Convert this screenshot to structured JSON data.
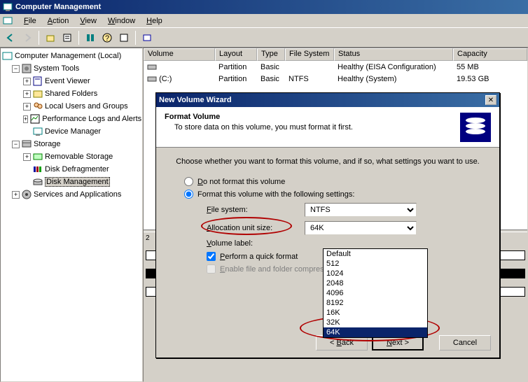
{
  "app": {
    "title": "Computer Management"
  },
  "menu": {
    "file": "File",
    "action": "Action",
    "view": "View",
    "window": "Window",
    "help": "Help"
  },
  "tree": {
    "root": "Computer Management (Local)",
    "systools": "System Tools",
    "eventviewer": "Event Viewer",
    "sharedfolders": "Shared Folders",
    "localusers": "Local Users and Groups",
    "perflogs": "Performance Logs and Alerts",
    "devmgr": "Device Manager",
    "storage": "Storage",
    "removable": "Removable Storage",
    "defrag": "Disk Defragmenter",
    "diskmgmt": "Disk Management",
    "services": "Services and Applications"
  },
  "cols": {
    "volume": "Volume",
    "layout": "Layout",
    "type": "Type",
    "fs": "File System",
    "status": "Status",
    "capacity": "Capacity"
  },
  "rows": [
    {
      "vol": "",
      "layout": "Partition",
      "type": "Basic",
      "fs": "",
      "status": "Healthy (EISA Configuration)",
      "cap": "55 MB"
    },
    {
      "vol": "(C:)",
      "layout": "Partition",
      "type": "Basic",
      "fs": "NTFS",
      "status": "Healthy (System)",
      "cap": "19.53 GB"
    }
  ],
  "wizard": {
    "title": "New Volume Wizard",
    "h1": "Format Volume",
    "h2": "To store data on this volume, you must format it first.",
    "intro": "Choose whether you want to format this volume, and if so, what settings you want to use.",
    "opt1": "Do not format this volume",
    "opt2": "Format this volume with the following settings:",
    "fs_label": "File system:",
    "fs_value": "NTFS",
    "au_label": "Allocation unit size:",
    "au_value": "64K",
    "vl_label": "Volume label:",
    "vl_value": "",
    "quick": "Perform a quick format",
    "compress": "Enable file and folder compression",
    "back": "< Back",
    "next": "Next >",
    "cancel": "Cancel",
    "options": [
      "Default",
      "512",
      "1024",
      "2048",
      "4096",
      "8192",
      "16K",
      "32K",
      "64K"
    ]
  },
  "disks": {
    "d2label": "2"
  }
}
